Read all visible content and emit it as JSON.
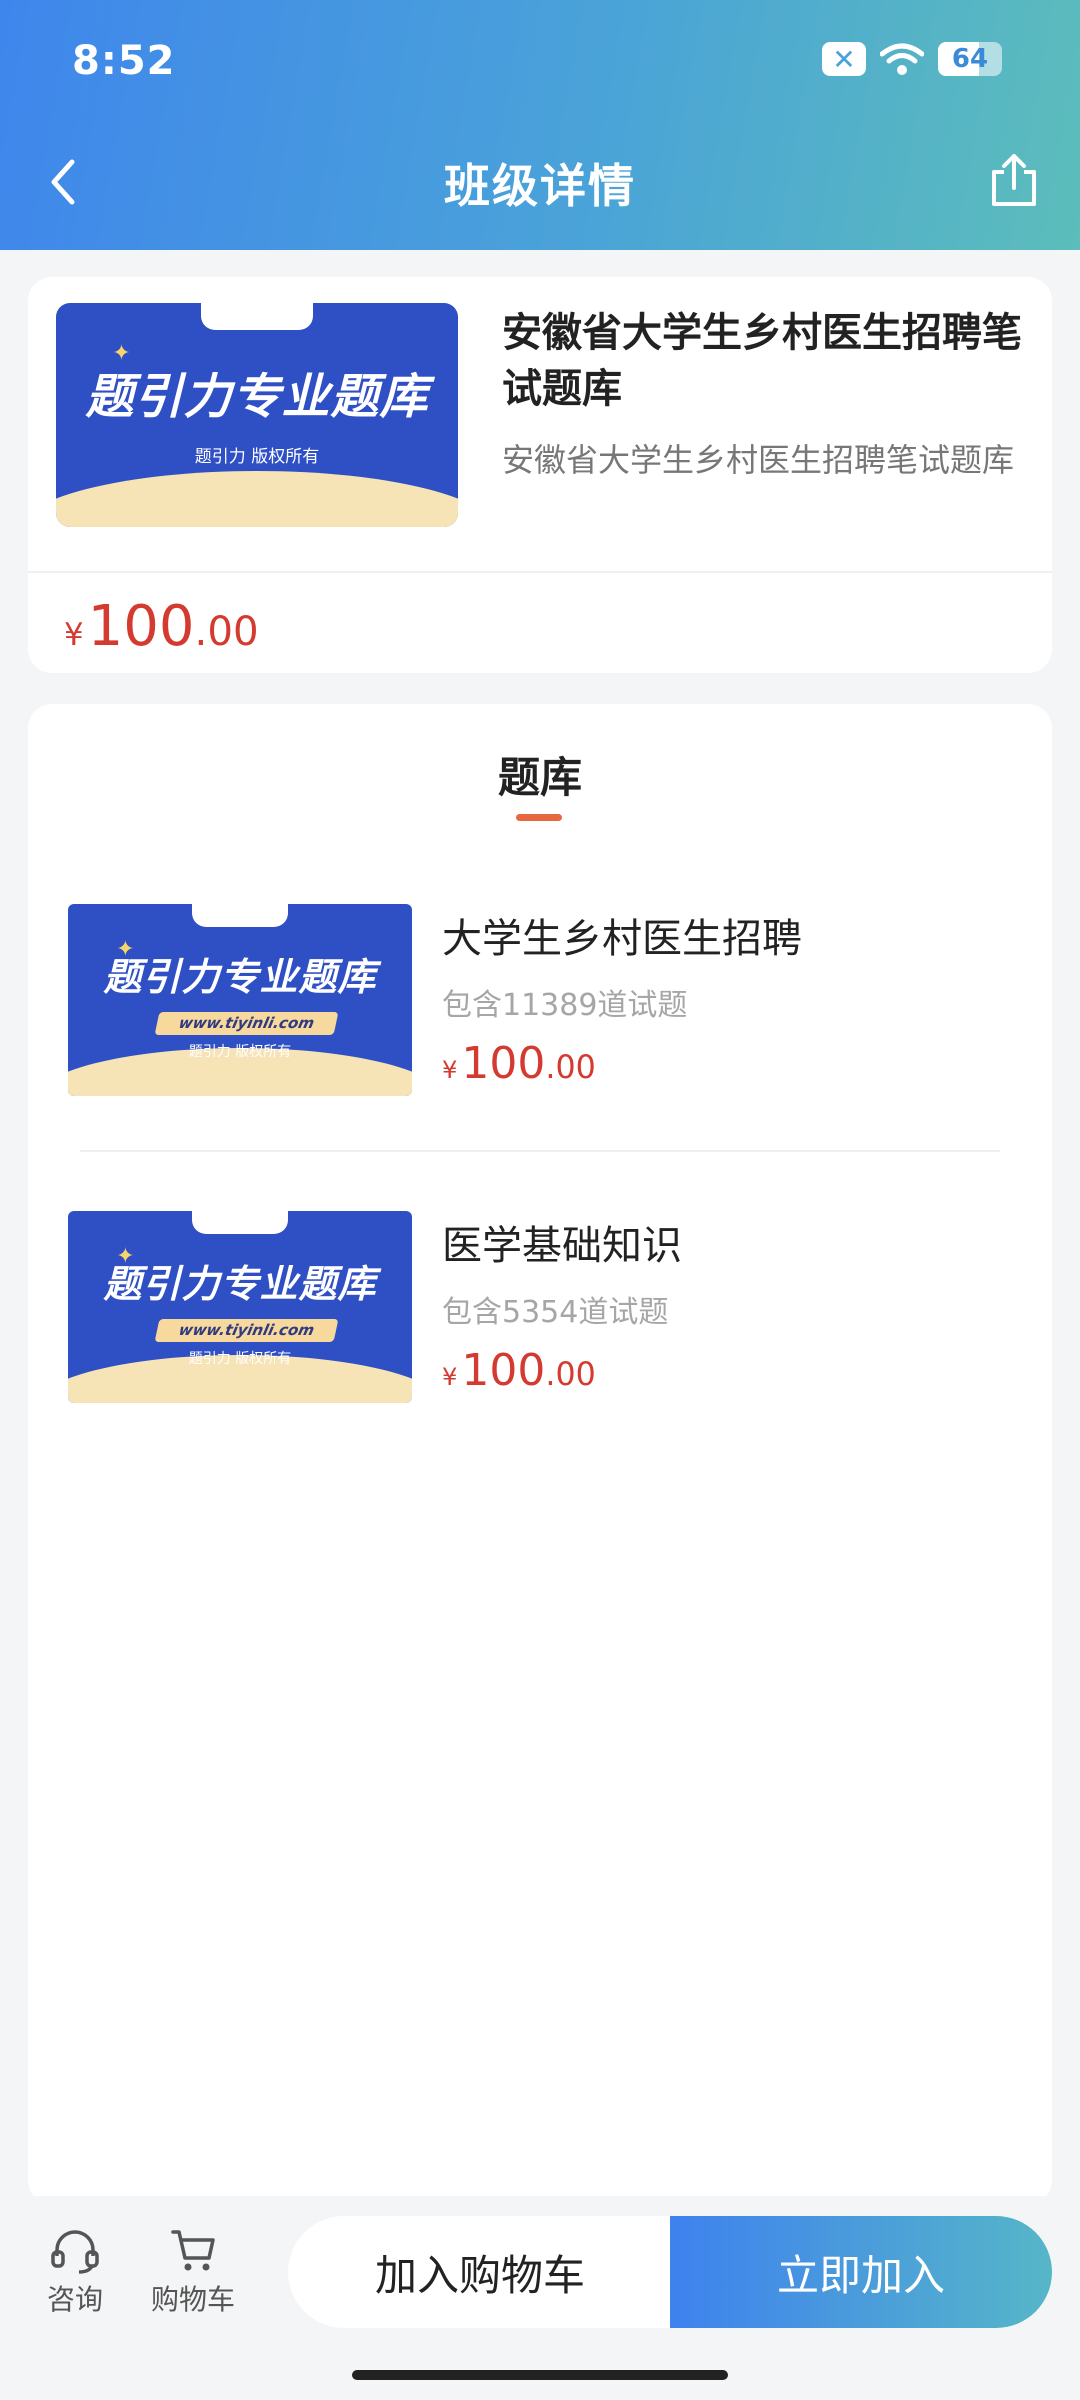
{
  "status": {
    "time": "8:52",
    "battery": "64"
  },
  "nav": {
    "title": "班级详情"
  },
  "course": {
    "title": "安徽省大学生乡村医生招聘笔试题库",
    "subtitle": "安徽省大学生乡村医生招聘笔试题库",
    "price_symbol": "¥",
    "price_int": "100",
    "price_dec": ".00"
  },
  "cover": {
    "title": "题引力专业题库",
    "copyright": "题引力 版权所有",
    "url": "www.tiyinli.com"
  },
  "section": {
    "title": "题库"
  },
  "libraries": [
    {
      "name": "大学生乡村医生招聘",
      "count": "包含11389道试题",
      "price_symbol": "¥",
      "price_int": "100",
      "price_dec": ".00"
    },
    {
      "name": "医学基础知识",
      "count": "包含5354道试题",
      "price_symbol": "¥",
      "price_int": "100",
      "price_dec": ".00"
    }
  ],
  "bottom": {
    "consult_label": "咨询",
    "cart_label": "购物车",
    "add_cart_button": "加入购物车",
    "join_button": "立即加入"
  },
  "colors": {
    "accent_blue": "#3f86ec",
    "price_red": "#d43a2f",
    "underline": "#e6683f"
  }
}
